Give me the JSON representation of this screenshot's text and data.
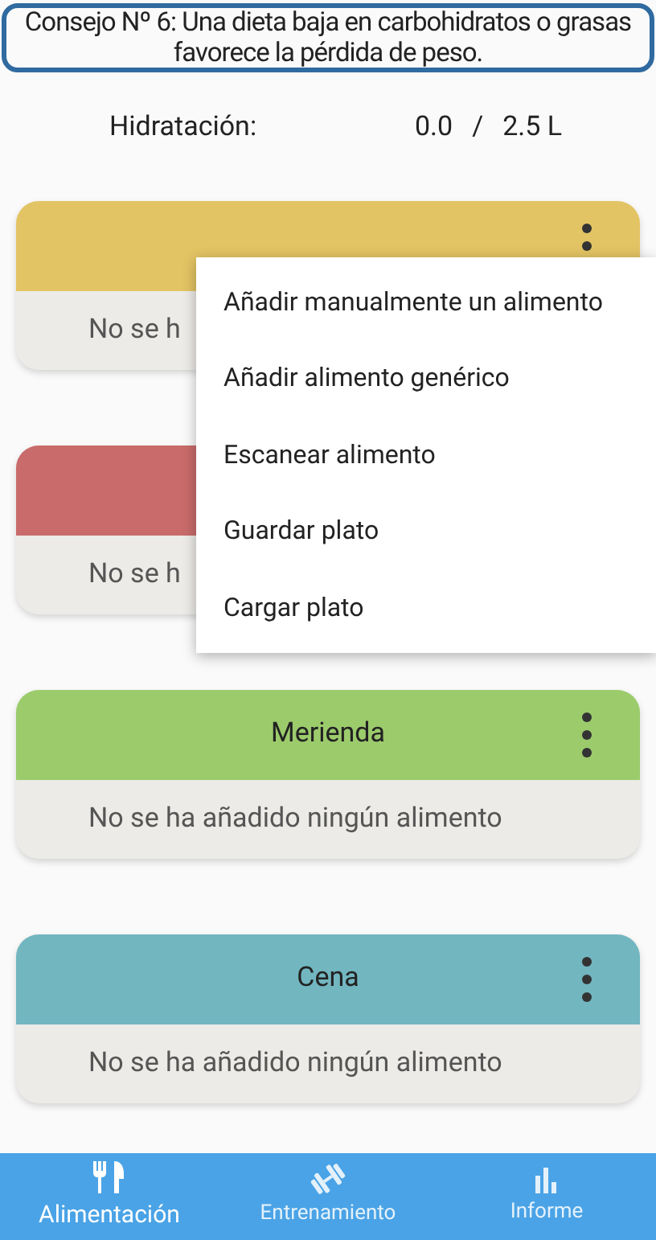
{
  "tip": "Consejo Nº 6: Una dieta baja en carbohidratos o grasas favorece la pérdida de peso.",
  "hydration": {
    "label": "Hidratación:",
    "current": "0.0",
    "separator": "/",
    "goal": "2.5 L"
  },
  "meals": [
    {
      "color": "#e3c464",
      "empty_text": "No se h",
      "options_button": true
    },
    {
      "color": "#c96b6b",
      "empty_text": "No se h"
    },
    {
      "title": "Merienda",
      "color": "#9ccb6c",
      "empty_text": "No se ha añadido ningún alimento",
      "options_button": true
    },
    {
      "title": "Cena",
      "color": "#72b6c0",
      "empty_text": "No se ha añadido ningún alimento",
      "options_button": true
    }
  ],
  "menu": [
    "Añadir manualmente un alimento",
    "Añadir alimento genérico",
    "Escanear alimento",
    "Guardar plato",
    "Cargar plato"
  ],
  "nav": [
    {
      "kind": "food",
      "label": "Alimentación",
      "selected": true
    },
    {
      "kind": "training",
      "label": "Entrenamiento",
      "selected": false
    },
    {
      "kind": "report",
      "label": "Informe",
      "selected": false
    }
  ]
}
